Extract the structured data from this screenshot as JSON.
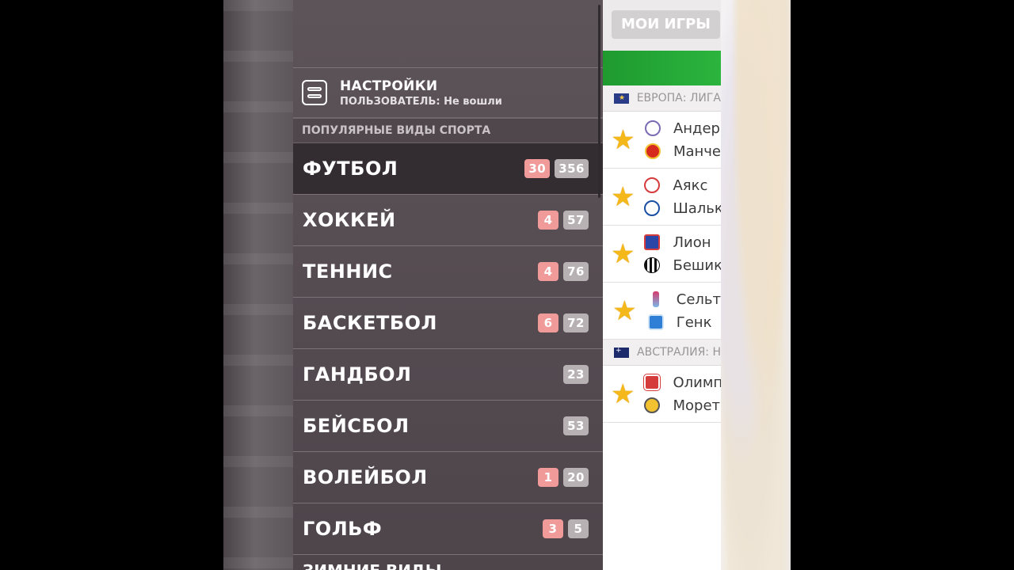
{
  "menu": {
    "settings_title": "НАСТРОЙКИ",
    "user_label": "ПОЛЬЗОВАТЕЛЬ: Не вошли",
    "section_popular": "ПОПУЛЯРНЫЕ ВИДЫ СПОРТА",
    "sports": [
      {
        "name": "ФУТБОЛ",
        "live": "30",
        "total": "356"
      },
      {
        "name": "ХОККЕЙ",
        "live": "4",
        "total": "57"
      },
      {
        "name": "ТЕННИС",
        "live": "4",
        "total": "76"
      },
      {
        "name": "БАСКЕТБОЛ",
        "live": "6",
        "total": "72"
      },
      {
        "name": "ГАНДБОЛ",
        "live": "",
        "total": "23"
      },
      {
        "name": "БЕЙСБОЛ",
        "live": "",
        "total": "53"
      },
      {
        "name": "ВОЛЕЙБОЛ",
        "live": "1",
        "total": "20"
      },
      {
        "name": "ГОЛЬФ",
        "live": "3",
        "total": "5"
      }
    ],
    "winter_section": "ЗИМНИЕ ВИДЫ"
  },
  "content": {
    "my_games_button": "МОИ ИГРЫ",
    "leagues": [
      {
        "label": "ЕВРОПА: ЛИГА",
        "flag": "eu-flag-icon"
      },
      {
        "label": "АВСТРАЛИЯ: Н",
        "flag": "au-flag-icon"
      }
    ],
    "matches": [
      {
        "home": "Андер",
        "away": "Манче"
      },
      {
        "home": "Аякс",
        "away": "Шальк"
      },
      {
        "home": "Лион",
        "away": "Бешик"
      },
      {
        "home": "Сельт",
        "away": "Генк"
      },
      {
        "home": "Олимп",
        "away": "Морет"
      }
    ]
  },
  "colors": {
    "menu_bg": "#554c52",
    "active_row": "#332d31",
    "live_badge": "#f09a9a",
    "total_badge": "#b7b1b4",
    "green_bar": "#2bb43e",
    "star": "#f5b81a"
  }
}
